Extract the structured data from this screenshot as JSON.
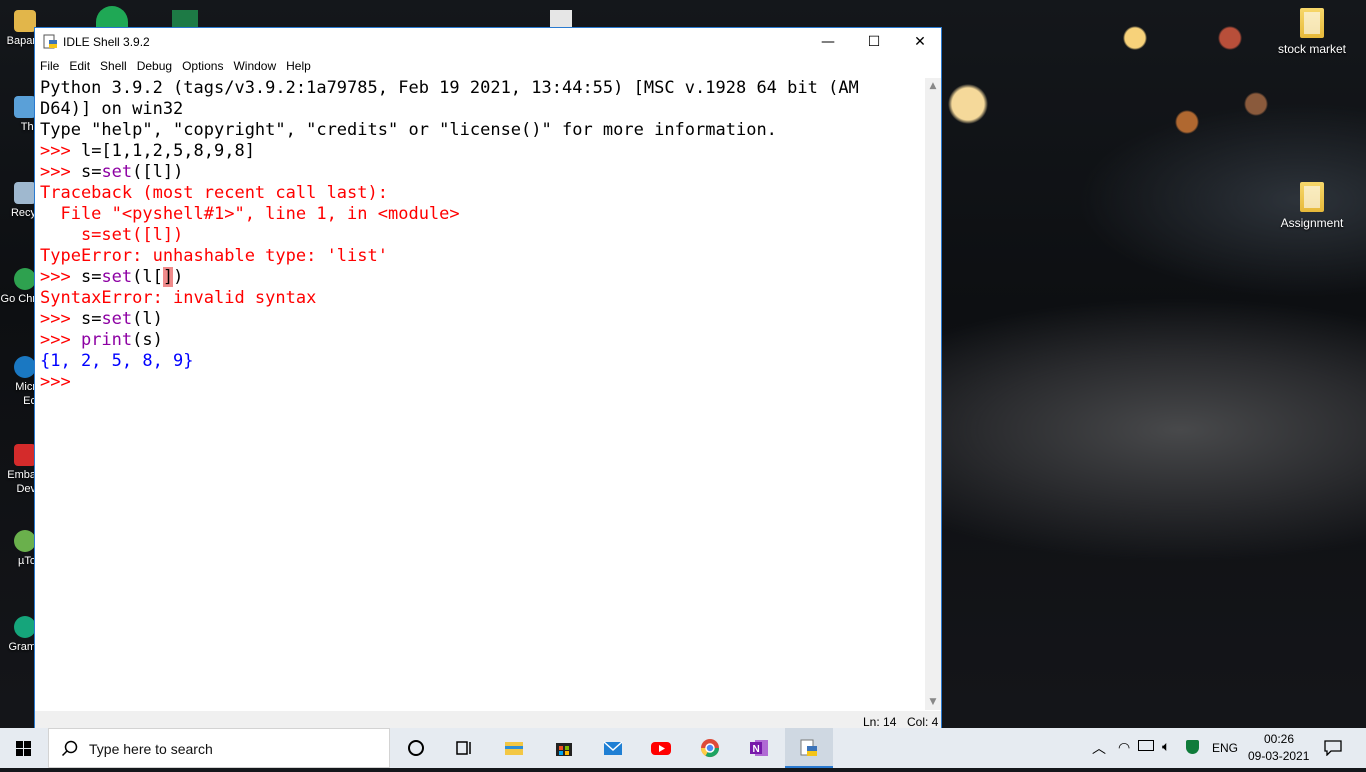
{
  "desktop": {
    "right_icons": [
      {
        "label": "stock market"
      },
      {
        "label": "Assignment"
      }
    ],
    "left_icons": [
      {
        "label": "Bapar"
      },
      {
        "label": "Thi"
      },
      {
        "label": "Recy"
      },
      {
        "label": "Go Chr"
      },
      {
        "label": "Micr Ec"
      },
      {
        "label": "Emba Dev"
      },
      {
        "label": "µTo"
      },
      {
        "label": "Gram"
      }
    ]
  },
  "window": {
    "title": "IDLE Shell 3.9.2",
    "controls": {
      "minimize": "—",
      "maximize": "☐",
      "close": "✕"
    },
    "menu": [
      "File",
      "Edit",
      "Shell",
      "Debug",
      "Options",
      "Window",
      "Help"
    ],
    "shell_lines": [
      [
        {
          "t": "Python 3.9.2 (tags/v3.9.2:1a79785, Feb 19 2021, 13:44:55) [MSC v.1928 64 bit (AM",
          "c": "blk"
        }
      ],
      [
        {
          "t": "D64)] on win32",
          "c": "blk"
        }
      ],
      [
        {
          "t": "Type \"help\", \"copyright\", \"credits\" or \"license()\" for more information.",
          "c": "blk"
        }
      ],
      [
        {
          "t": ">>> ",
          "c": "red"
        },
        {
          "t": "l=[1,1,2,5,8,9,8]",
          "c": "blk"
        }
      ],
      [
        {
          "t": ">>> ",
          "c": "red"
        },
        {
          "t": "s=",
          "c": "blk"
        },
        {
          "t": "set",
          "c": "mag"
        },
        {
          "t": "([l])",
          "c": "blk"
        }
      ],
      [
        {
          "t": "Traceback (most recent call last):",
          "c": "red"
        }
      ],
      [
        {
          "t": "  File \"<pyshell#1>\", line 1, in <module>",
          "c": "red"
        }
      ],
      [
        {
          "t": "    s=set([l])",
          "c": "red"
        }
      ],
      [
        {
          "t": "TypeError: unhashable type: 'list'",
          "c": "red"
        }
      ],
      [
        {
          "t": ">>> ",
          "c": "red"
        },
        {
          "t": "s=",
          "c": "blk"
        },
        {
          "t": "set",
          "c": "mag"
        },
        {
          "t": "(l[",
          "c": "blk"
        },
        {
          "t": "]",
          "c": "cur"
        },
        {
          "t": ")",
          "c": "blk"
        }
      ],
      [
        {
          "t": "SyntaxError: invalid syntax",
          "c": "red"
        }
      ],
      [
        {
          "t": ">>> ",
          "c": "red"
        },
        {
          "t": "s=",
          "c": "blk"
        },
        {
          "t": "set",
          "c": "mag"
        },
        {
          "t": "(l)",
          "c": "blk"
        }
      ],
      [
        {
          "t": ">>> ",
          "c": "red"
        },
        {
          "t": "print",
          "c": "mag"
        },
        {
          "t": "(s)",
          "c": "blk"
        }
      ],
      [
        {
          "t": "{1, 2, 5, 8, 9}",
          "c": "blu"
        }
      ],
      [
        {
          "t": ">>> ",
          "c": "red"
        }
      ]
    ],
    "status": {
      "line": "Ln: 14",
      "col": "Col: 4"
    }
  },
  "taskbar": {
    "search_placeholder": "Type here to search",
    "apps": [
      "cortana-icon",
      "task-view-icon",
      "file-explorer-icon",
      "store-icon",
      "mail-icon",
      "youtube-icon",
      "chrome-icon",
      "onenote-icon",
      "python-idle-icon"
    ],
    "tray": {
      "language": "ENG",
      "time": "00:26",
      "date": "09-03-2021"
    }
  }
}
